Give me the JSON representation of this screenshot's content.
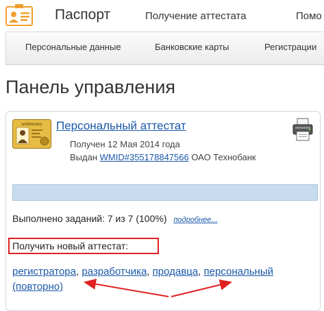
{
  "header": {
    "app_title": "Паспорт",
    "nav": [
      "Получение аттестата",
      "Помо"
    ]
  },
  "subnav": [
    "Персональные данные",
    "Банковские карты",
    "Регистрации"
  ],
  "page_title": "Панель управления",
  "certificate": {
    "badge_text": "webmoney",
    "title": "Персональный аттестат",
    "received": "Получен 12 Мая 2014 года",
    "issued_prefix": "Выдан",
    "wmid": "WMID#355178847566",
    "issuer": "ОАО Технобанк",
    "progress_fraction": 1.0,
    "tasks_text": "Выполнено заданий: 7 из 7 (100%)",
    "details_link": "подробнее..."
  },
  "new_cert": {
    "label": "Получить новый аттестат:",
    "links": [
      "регистратора",
      "разработчика",
      "продавца",
      "персональный (повторно)"
    ]
  },
  "colors": {
    "link": "#1a58a7",
    "highlight": "#e02020",
    "progress": "#c3d9ee"
  },
  "icons": [
    "passport-logo-icon",
    "printer-icon",
    "certificate-badge-icon"
  ]
}
